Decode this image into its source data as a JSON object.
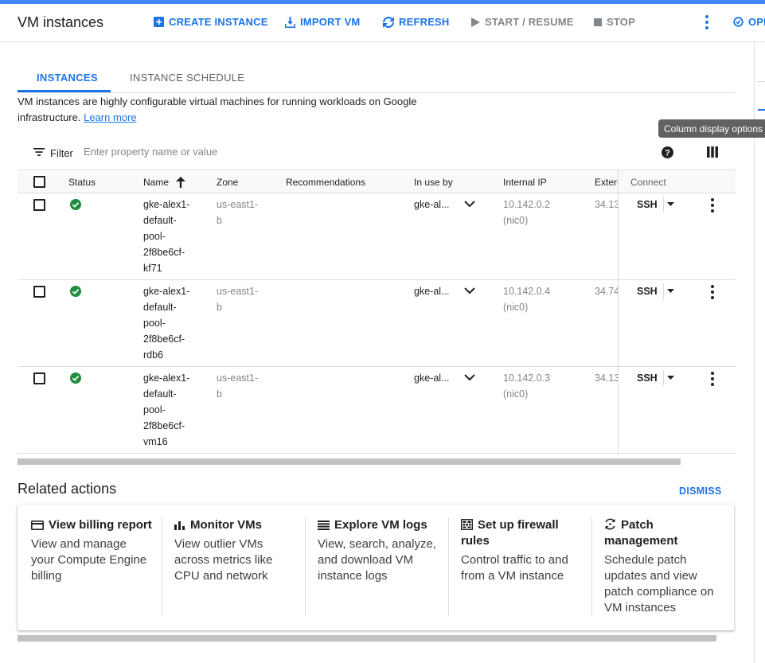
{
  "colors": {
    "accent": "#1a73e8",
    "success": "#1e8e3e",
    "muted": "#80868b"
  },
  "header": {
    "title": "VM instances",
    "actions": {
      "create": "CREATE INSTANCE",
      "import": "IMPORT VM",
      "refresh": "REFRESH",
      "start": "START / RESUME",
      "stop": "STOP",
      "ops": "OPE"
    }
  },
  "tabs": {
    "instances": "INSTANCES",
    "schedule": "INSTANCE SCHEDULE"
  },
  "description": {
    "text": "VM instances are highly configurable virtual machines for running workloads on Google infrastructure.",
    "link": "Learn more"
  },
  "tooltip": "Column display options",
  "filter": {
    "label": "Filter",
    "placeholder": "Enter property name or value"
  },
  "table": {
    "columns": {
      "status": "Status",
      "name": "Name",
      "zone": "Zone",
      "recommendations": "Recommendations",
      "in_use_by": "In use by",
      "internal_ip": "Internal IP",
      "external_ip": "Extern",
      "connect": "Connect"
    },
    "rows": [
      {
        "name_lines": [
          "gke-alex1-",
          "default-",
          "pool-",
          "2f8be6cf-",
          "kf71"
        ],
        "zone_lines": [
          "us-east1-",
          "b"
        ],
        "in_use_by": "gke-al...",
        "internal_ip_lines": [
          "10.142.0.2",
          "(nic0)"
        ],
        "external_ip": "34.13",
        "connect": "SSH"
      },
      {
        "name_lines": [
          "gke-alex1-",
          "default-",
          "pool-",
          "2f8be6cf-",
          "rdb6"
        ],
        "zone_lines": [
          "us-east1-",
          "b"
        ],
        "in_use_by": "gke-al...",
        "internal_ip_lines": [
          "10.142.0.4",
          "(nic0)"
        ],
        "external_ip": "34.74",
        "connect": "SSH"
      },
      {
        "name_lines": [
          "gke-alex1-",
          "default-",
          "pool-",
          "2f8be6cf-",
          "vm16"
        ],
        "zone_lines": [
          "us-east1-",
          "b"
        ],
        "in_use_by": "gke-al...",
        "internal_ip_lines": [
          "10.142.0.3",
          "(nic0)"
        ],
        "external_ip": "34.13",
        "connect": "SSH"
      }
    ]
  },
  "related": {
    "title": "Related actions",
    "dismiss": "DISMISS",
    "cards": [
      {
        "title": "View billing report",
        "icon": "billing-icon",
        "body_lines": [
          "View and manage",
          "your Compute Engine",
          "billing"
        ]
      },
      {
        "title": "Monitor VMs",
        "icon": "monitoring-icon",
        "body_lines": [
          "View outlier VMs",
          "across metrics like",
          "CPU and network"
        ]
      },
      {
        "title": "Explore VM logs",
        "icon": "logs-icon",
        "body_lines": [
          "View, search, analyze,",
          "and download VM",
          "instance logs"
        ]
      },
      {
        "title_lines": [
          "Set up firewall",
          "rules"
        ],
        "icon": "firewall-icon",
        "body_lines": [
          "Control traffic to and",
          "from a VM instance"
        ]
      },
      {
        "title_lines": [
          "Patch",
          "management"
        ],
        "icon": "patch-icon",
        "body_lines": [
          "Schedule patch",
          "updates and view",
          "patch compliance on",
          "VM instances"
        ]
      }
    ]
  }
}
